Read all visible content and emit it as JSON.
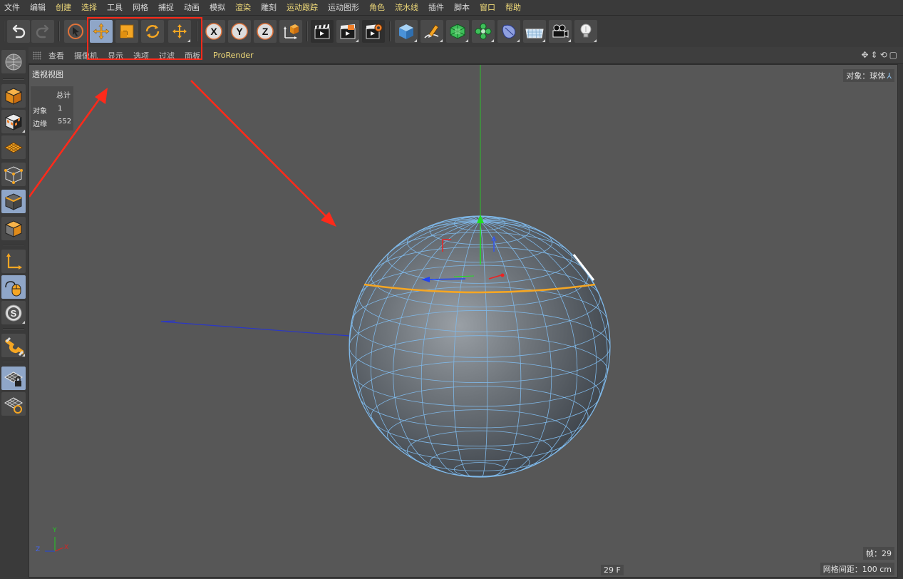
{
  "menubar": {
    "items": [
      {
        "label": "文件",
        "hl": false
      },
      {
        "label": "编辑",
        "hl": false
      },
      {
        "label": "创建",
        "hl": true
      },
      {
        "label": "选择",
        "hl": true
      },
      {
        "label": "工具",
        "hl": false
      },
      {
        "label": "网格",
        "hl": false
      },
      {
        "label": "捕捉",
        "hl": false
      },
      {
        "label": "动画",
        "hl": false
      },
      {
        "label": "模拟",
        "hl": false
      },
      {
        "label": "渲染",
        "hl": true
      },
      {
        "label": "雕刻",
        "hl": false
      },
      {
        "label": "运动跟踪",
        "hl": true
      },
      {
        "label": "运动图形",
        "hl": false
      },
      {
        "label": "角色",
        "hl": true
      },
      {
        "label": "流水线",
        "hl": true
      },
      {
        "label": "插件",
        "hl": false
      },
      {
        "label": "脚本",
        "hl": false
      },
      {
        "label": "窗口",
        "hl": true
      },
      {
        "label": "帮助",
        "hl": true
      }
    ]
  },
  "viewport_menu": {
    "items": [
      "查看",
      "摄像机",
      "显示",
      "选项",
      "过滤",
      "面板"
    ],
    "prorender": "ProRender"
  },
  "viewport": {
    "title": "透视视图",
    "object_label": "对象：球体",
    "stats": {
      "header": "总计",
      "rows": [
        {
          "label": "对象",
          "value": "1"
        },
        {
          "label": "边缘",
          "value": "552"
        }
      ]
    },
    "frame_label": "帧：29",
    "frame_bottom": "29 F",
    "grid_spacing": "网格间距：100 cm",
    "axis": {
      "x": "X",
      "y": "Y",
      "z": "Z"
    }
  },
  "colors": {
    "selection_frame": "#ff2a1a",
    "arrow": "#ff2a1a",
    "accent": "#f2dc7a",
    "sphere_wire": "#7fb8e8",
    "edge_selected": "#f5a623",
    "y_axis": "#22cc22",
    "x_axis": "#dd2222",
    "z_axis": "#2244dd"
  },
  "icons": {
    "toolbar": [
      "undo-icon",
      "redo-icon",
      "select-arrow-icon",
      "move-icon",
      "scale-icon",
      "rotate-icon",
      "last-tool-icon",
      "x-axis-icon",
      "y-axis-icon",
      "z-axis-icon",
      "coordinate-system-icon",
      "render-view-icon",
      "render-picture-viewer-icon",
      "render-settings-icon",
      "cube-icon",
      "pen-icon",
      "subdivision-icon",
      "cloner-icon",
      "deformer-icon",
      "floor-icon",
      "camera-icon",
      "light-icon"
    ],
    "leftbar": [
      "make-editable-icon",
      "model-mode-icon",
      "texture-mode-icon",
      "workplane-icon",
      "points-mode-icon",
      "edges-mode-icon",
      "polygons-mode-icon",
      "axis-mode-icon",
      "tweak-mode-icon",
      "solo-icon",
      "snap-icon",
      "workplane-lock-icon",
      "workplane-lock-2-icon"
    ]
  }
}
